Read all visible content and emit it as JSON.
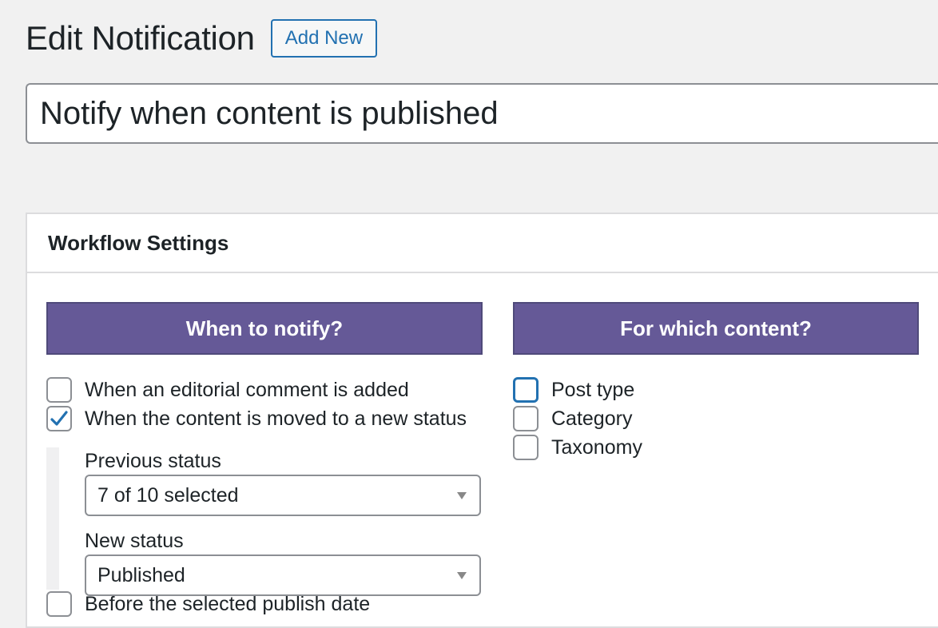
{
  "header": {
    "title": "Edit Notification",
    "add_new_label": "Add New"
  },
  "title_field": {
    "value": "Notify when content is published"
  },
  "workflow": {
    "title": "Workflow Settings",
    "when": {
      "heading": "When to notify?",
      "options": [
        {
          "label": "When an editorial comment is added",
          "checked": false
        },
        {
          "label": "When the content is moved to a new status",
          "checked": true
        },
        {
          "label": "Before the selected publish date",
          "checked": false
        }
      ],
      "previous_status_label": "Previous status",
      "previous_status_value": "7 of 10 selected",
      "new_status_label": "New status",
      "new_status_value": "Published"
    },
    "content": {
      "heading": "For which content?",
      "options": [
        {
          "label": "Post type",
          "checked": false
        },
        {
          "label": "Category",
          "checked": false
        },
        {
          "label": "Taxonomy",
          "checked": false
        }
      ]
    }
  },
  "colors": {
    "accent": "#2271b1",
    "column_header": "#655997"
  }
}
